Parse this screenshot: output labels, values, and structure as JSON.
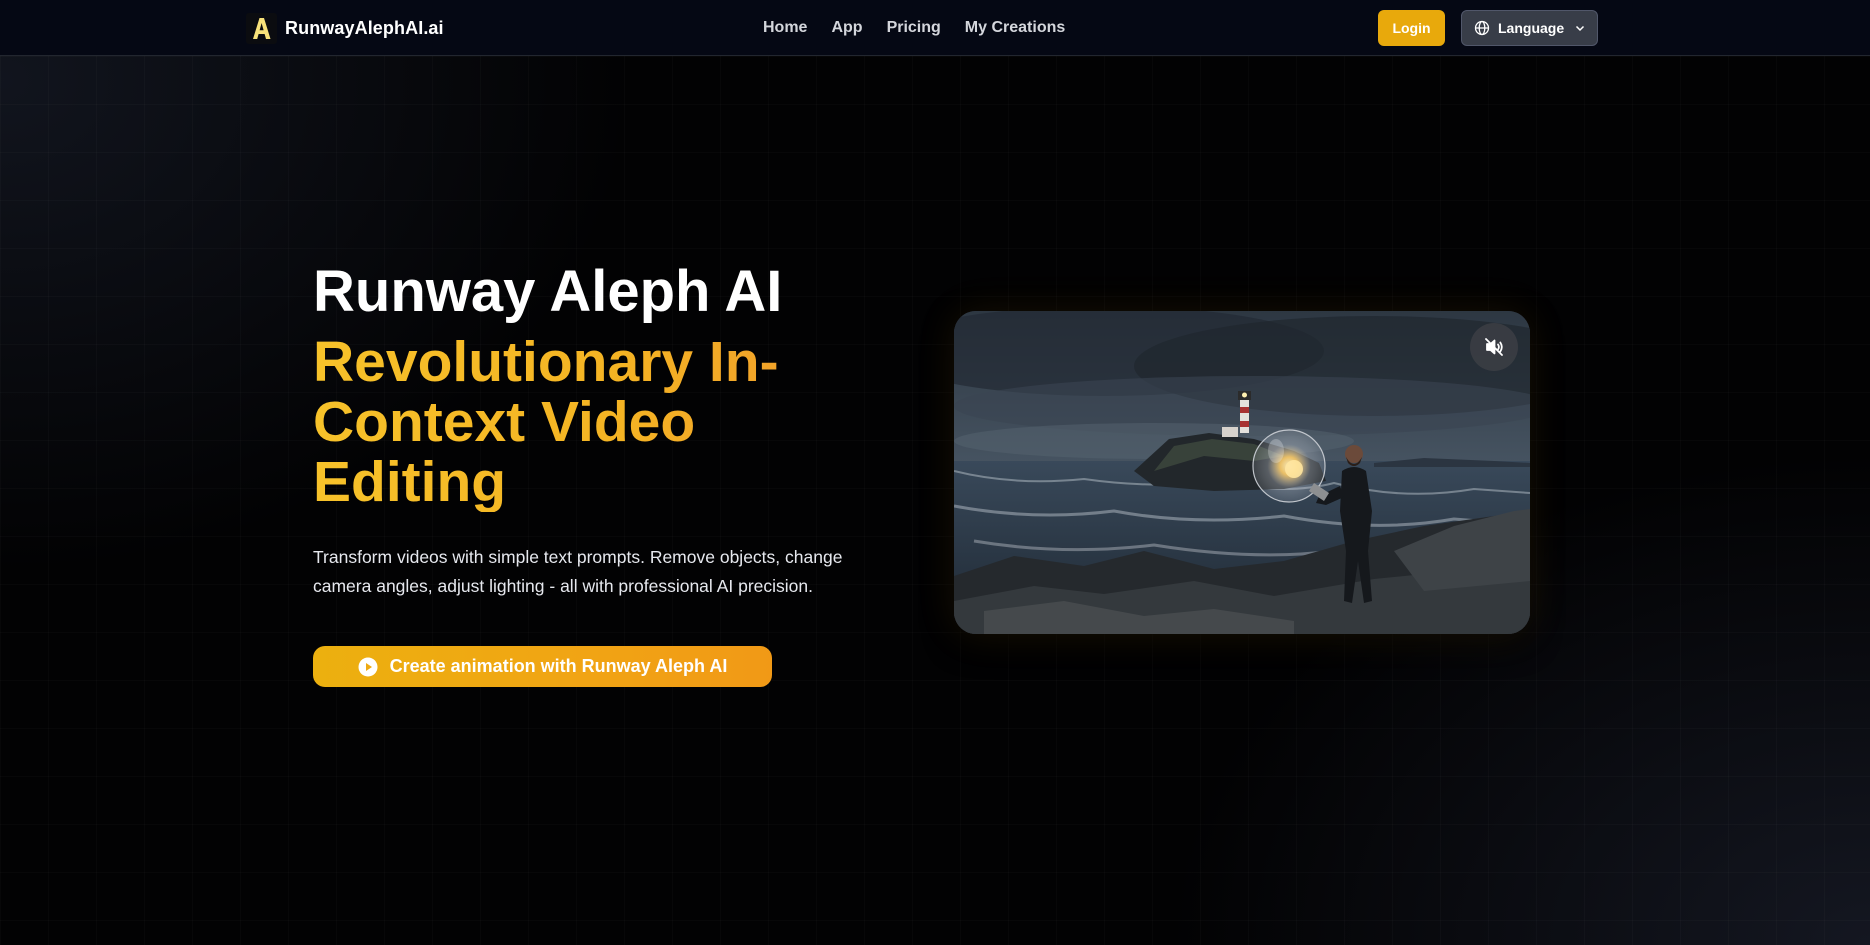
{
  "header": {
    "brand": "RunwayAlephAI.ai",
    "nav": [
      "Home",
      "App",
      "Pricing",
      "My Creations"
    ],
    "login_label": "Login",
    "language_label": "Language"
  },
  "hero": {
    "title": "Runway Aleph AI",
    "subtitle": "Revolutionary In-Context Video Editing",
    "description": "Transform videos with simple text prompts. Remove objects, change camera angles, adjust lighting - all with professional AI precision.",
    "cta_label": "Create animation with Runway Aleph AI"
  },
  "icons": {
    "logo": "letter-a-logo",
    "language": "globe-icon",
    "dropdown": "chevron-down-icon",
    "cta": "play-circle-icon",
    "video_control": "muted-speaker-icon"
  },
  "colors": {
    "accent": "#f5b51f",
    "login_bg": "#e8a90c",
    "header_bg": "#050814",
    "page_bg": "#020203"
  }
}
